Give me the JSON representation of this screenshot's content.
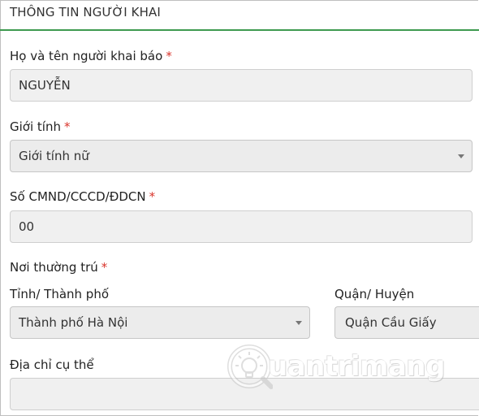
{
  "section": {
    "title": "THÔNG TIN NGƯỜI KHAI"
  },
  "full_name": {
    "label": "Họ và tên người khai báo",
    "required_mark": "*",
    "value": "NGUYỄN"
  },
  "gender": {
    "label": "Giới tính",
    "required_mark": "*",
    "selected": "Giới tính nữ"
  },
  "id_number": {
    "label": "Số CMND/CCCD/ĐDCN",
    "required_mark": "*",
    "value": "00"
  },
  "residence": {
    "label": "Nơi thường trú",
    "required_mark": "*",
    "province": {
      "label": "Tỉnh/ Thành phố",
      "selected": "Thành phố Hà Nội"
    },
    "district": {
      "label": "Quận/ Huyện",
      "selected": "Quận Cầu Giấy"
    },
    "address": {
      "label": "Địa chỉ cụ thể",
      "value": ""
    }
  },
  "watermark": {
    "text": "uantrimang"
  },
  "colors": {
    "accent_line": "#3e9a4f",
    "required": "#d9342b",
    "field_bg": "#f0f0f0"
  }
}
